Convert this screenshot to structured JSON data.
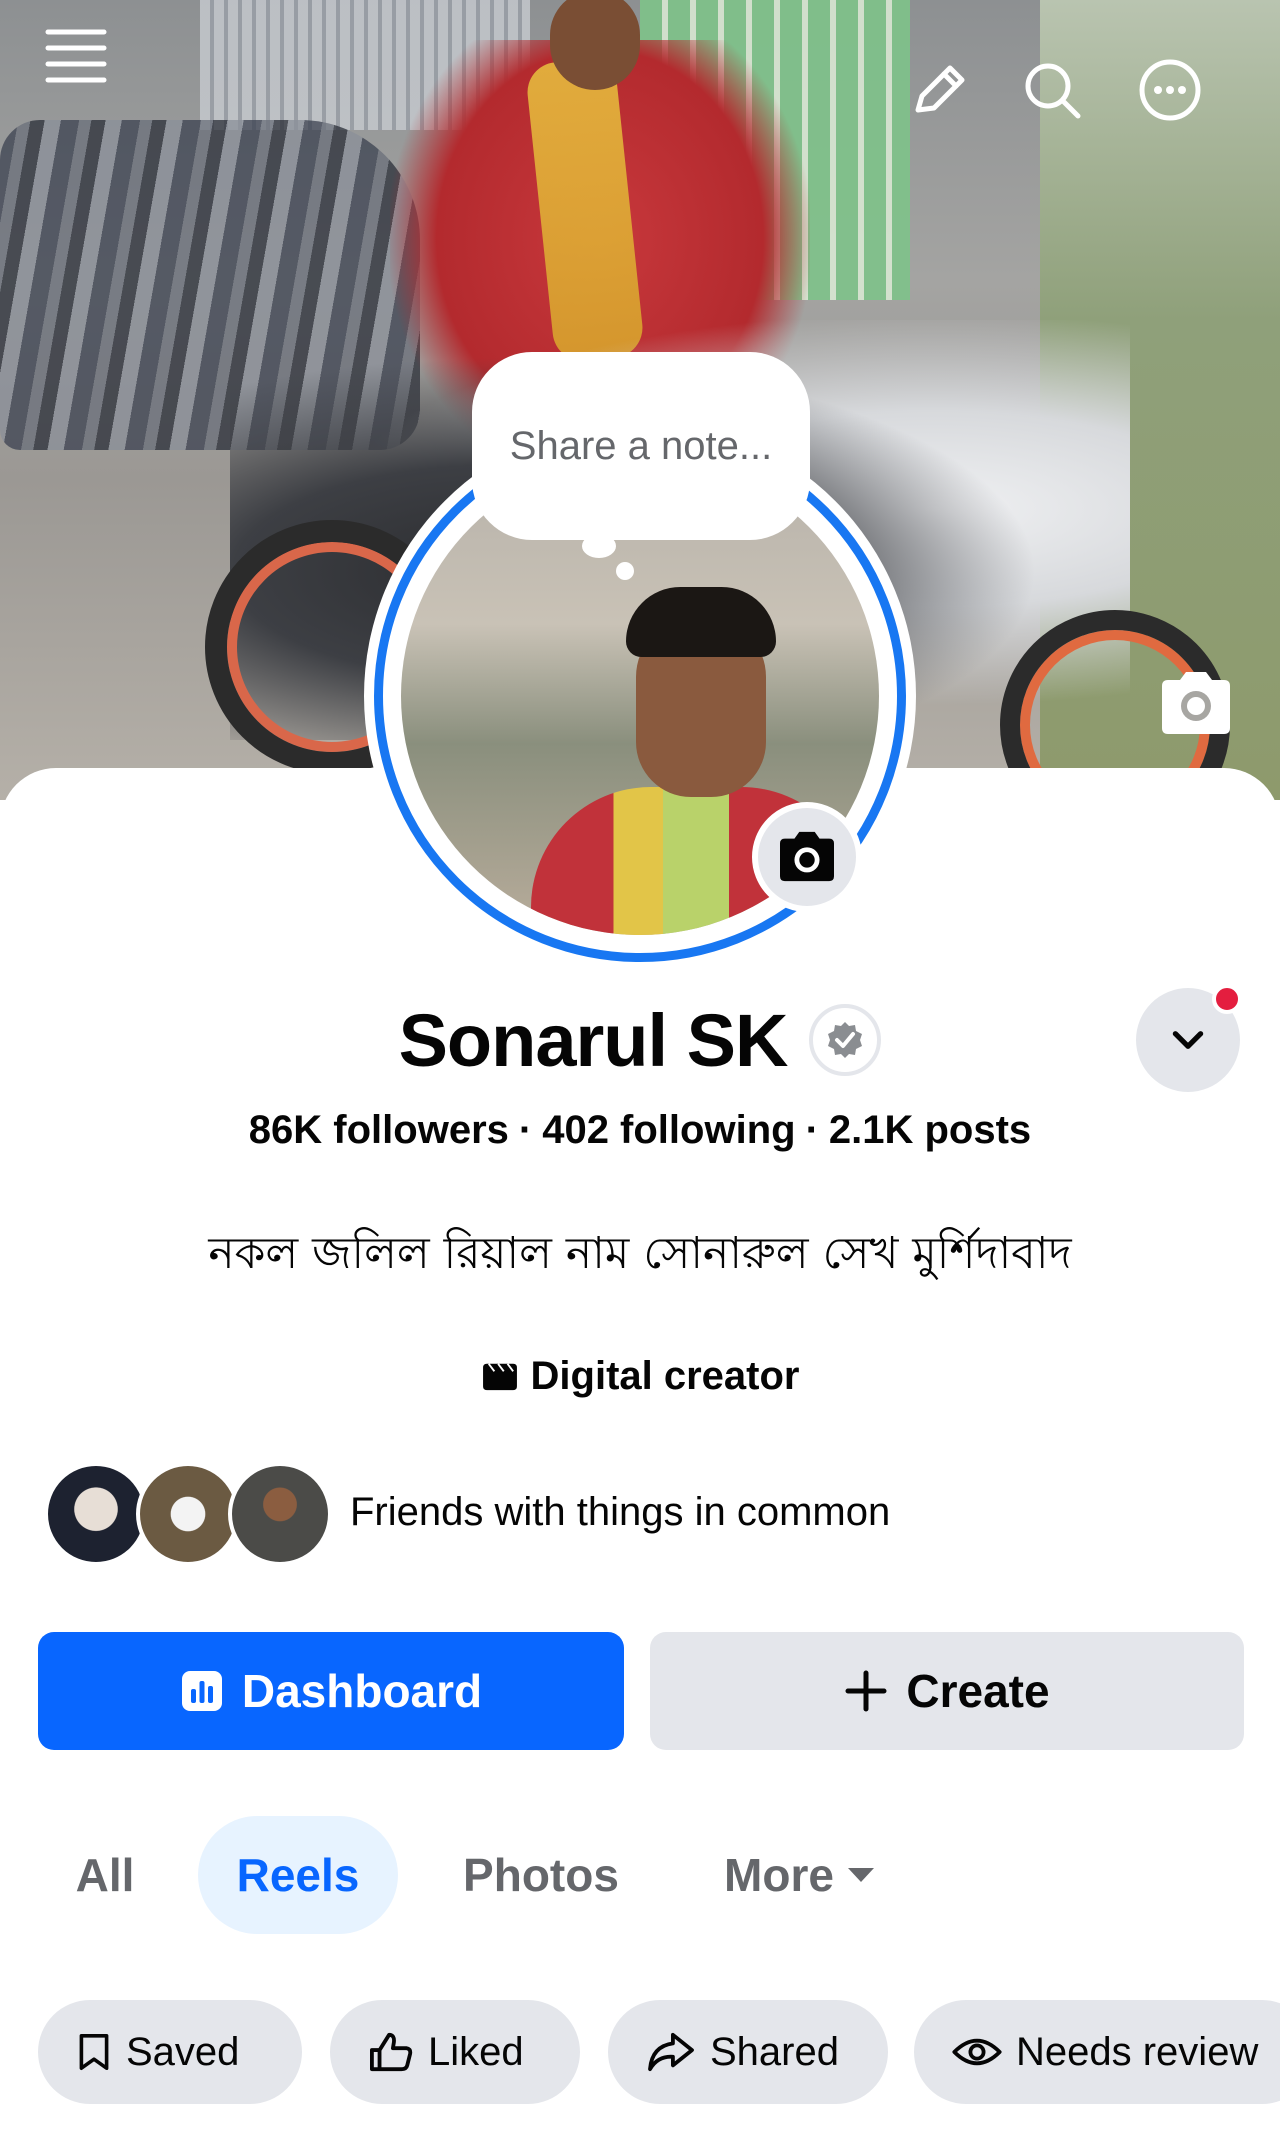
{
  "header": {
    "menu_icon": "hamburger-menu-icon",
    "edit_icon": "pencil-icon",
    "search_icon": "search-icon",
    "more_icon": "more-options-icon"
  },
  "note": {
    "placeholder": "Share a note..."
  },
  "profile": {
    "name": "Sonarul SK",
    "followers": "86K followers",
    "following": "402 following",
    "posts": "2.1K posts",
    "separator": "·",
    "bio": "নকল জলিল রিয়াল নাম সোনারুল সেখ মুর্শিদাবাদ",
    "category": "Digital creator",
    "friends_label": "Friends with things in common"
  },
  "actions": {
    "dashboard_label": "Dashboard",
    "create_label": "Create"
  },
  "tabs": [
    {
      "label": "All",
      "selected": false
    },
    {
      "label": "Reels",
      "selected": true
    },
    {
      "label": "Photos",
      "selected": false
    },
    {
      "label": "More",
      "selected": false
    }
  ],
  "chips": [
    {
      "label": "Saved",
      "icon": "bookmark-icon"
    },
    {
      "label": "Liked",
      "icon": "thumbs-up-icon"
    },
    {
      "label": "Shared",
      "icon": "share-arrow-icon"
    },
    {
      "label": "Needs review",
      "icon": "eye-icon"
    }
  ],
  "colors": {
    "accent_blue": "#0866ff",
    "ring_blue": "#1877f2",
    "tab_selected_bg": "#e7f3ff",
    "button_gray": "#e4e6eb",
    "notification_red": "#e41e3f",
    "secondary_text": "#65676b"
  }
}
